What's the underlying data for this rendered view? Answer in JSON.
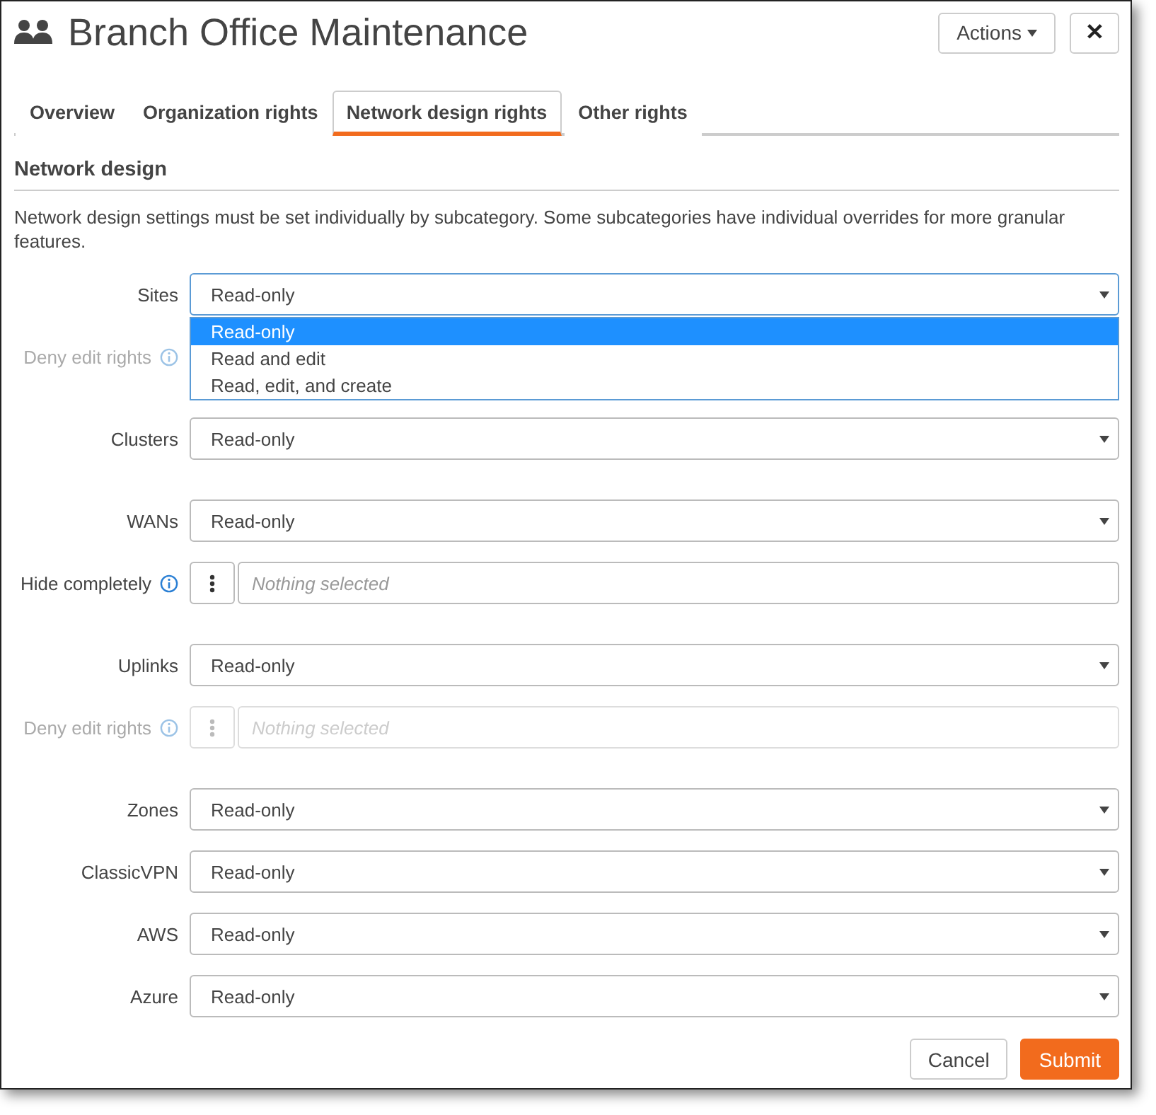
{
  "window": {
    "title": "Branch Office Maintenance"
  },
  "actions_button": "Actions",
  "close_button": "✕",
  "tabs": [
    {
      "label": "Overview",
      "selected": false
    },
    {
      "label": "Organization rights",
      "selected": false
    },
    {
      "label": "Network design rights",
      "selected": true
    },
    {
      "label": "Other rights",
      "selected": false
    }
  ],
  "section": {
    "title": "Network design",
    "description": "Network design settings must be set individually by subcategory. Some subcategories have individual overrides for more granular features."
  },
  "groups": [
    {
      "rows": [
        {
          "kind": "select",
          "label": "Sites",
          "value": "Read-only",
          "disabled": false,
          "open": true,
          "options": [
            {
              "label": "Read-only",
              "selected": true
            },
            {
              "label": "Read and edit",
              "selected": false
            },
            {
              "label": "Read, edit, and create",
              "selected": false
            }
          ]
        },
        {
          "kind": "label",
          "label": "Deny edit rights",
          "disabled": true,
          "info": true
        }
      ]
    },
    {
      "rows": [
        {
          "kind": "select",
          "label": "Clusters",
          "value": "Read-only",
          "disabled": false,
          "open": false
        }
      ]
    },
    {
      "rows": [
        {
          "kind": "select",
          "label": "WANs",
          "value": "Read-only",
          "disabled": false,
          "open": false
        },
        {
          "kind": "multi",
          "label": "Hide completely",
          "placeholder": "Nothing selected",
          "disabled": false,
          "info": true
        }
      ]
    },
    {
      "rows": [
        {
          "kind": "select",
          "label": "Uplinks",
          "value": "Read-only",
          "disabled": false,
          "open": false
        },
        {
          "kind": "multi",
          "label": "Deny edit rights",
          "placeholder": "Nothing selected",
          "disabled": true,
          "info": true
        }
      ]
    },
    {
      "rows": [
        {
          "kind": "select",
          "label": "Zones",
          "value": "Read-only",
          "disabled": false,
          "open": false
        },
        {
          "kind": "select",
          "label": "ClassicVPN",
          "value": "Read-only",
          "disabled": false,
          "open": false
        },
        {
          "kind": "select",
          "label": "AWS",
          "value": "Read-only",
          "disabled": false,
          "open": false
        },
        {
          "kind": "select",
          "label": "Azure",
          "value": "Read-only",
          "disabled": false,
          "open": false
        }
      ]
    }
  ],
  "footer": {
    "cancel": "Cancel",
    "submit": "Submit"
  }
}
